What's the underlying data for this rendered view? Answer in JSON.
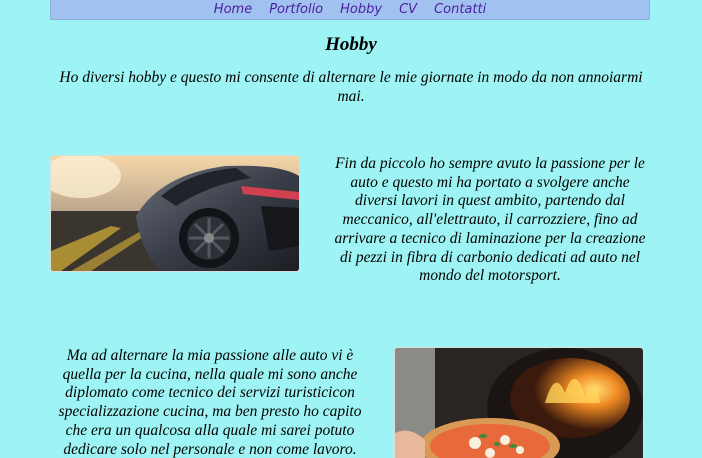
{
  "nav": {
    "items": [
      {
        "label": "Home"
      },
      {
        "label": "Portfolio"
      },
      {
        "label": "Hobby"
      },
      {
        "label": "CV"
      },
      {
        "label": "Contatti"
      }
    ]
  },
  "page": {
    "title": "Hobby",
    "intro": "Ho diversi hobby e questo mi consente di alternare le mie giornate in modo da non annoiarmi mai."
  },
  "sections": [
    {
      "text": "Fin da piccolo ho sempre avuto la passione per le auto e questo mi ha portato a svolgere anche diversi lavori in quest ambito, partendo dal meccanico, all'elettrauto, il carrozziere, fino ad arrivare a tecnico di laminazione per la creazione di pezzi in fibra di carbonio dedicati ad auto nel mondo del motorsport."
    },
    {
      "text": "Ma ad alternare la mia passione alle auto vi è quella per la cucina, nella quale mi sono anche diplomato come tecnico dei servizi turisticicon specializzazione cucina, ma ben presto ho capito che era un qualcosa alla quale mi sarei potuto dedicare solo nel personale e non come lavoro."
    }
  ],
  "colors": {
    "background": "#9ef4f4",
    "nav_background": "#a1c2f0",
    "nav_link": "#4b1fa0"
  }
}
